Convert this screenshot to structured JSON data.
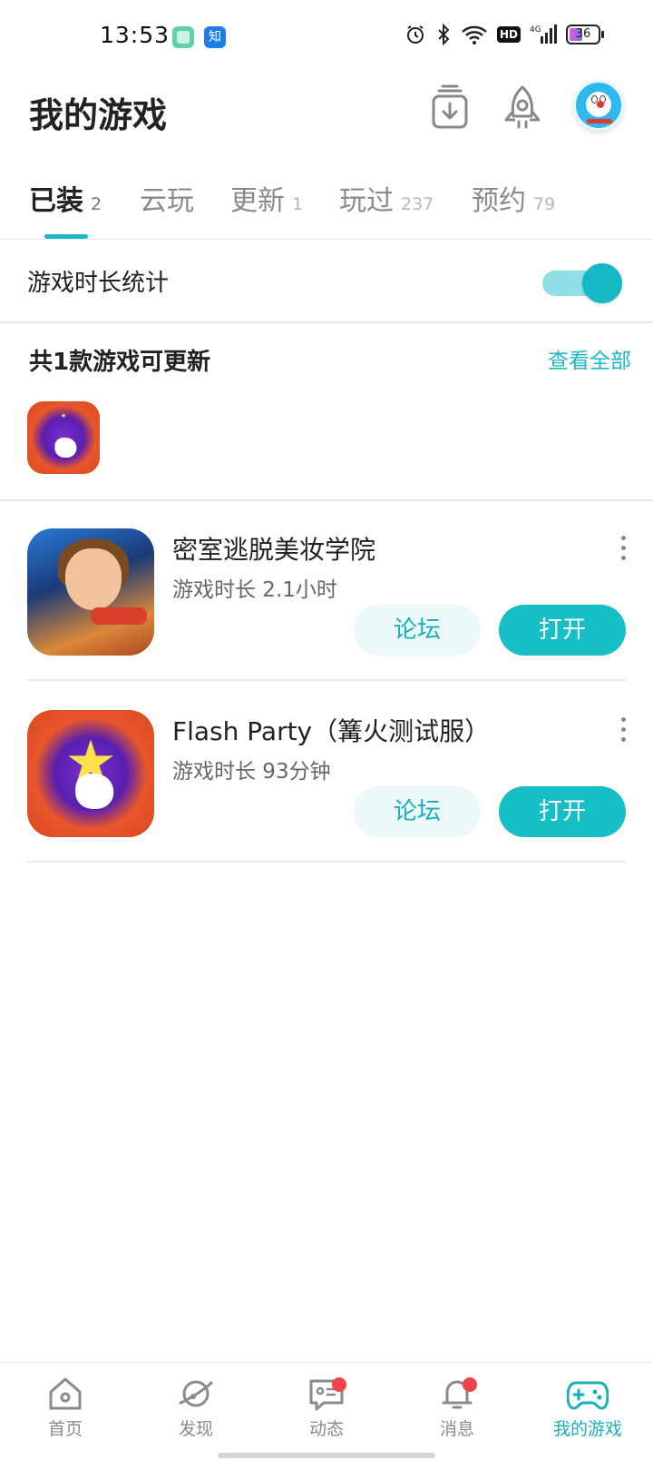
{
  "status_bar": {
    "time": "13:53",
    "app2_label": "知",
    "hd": "HD",
    "network": "4G",
    "battery": "36"
  },
  "header": {
    "title": "我的游戏"
  },
  "tabs": [
    {
      "label": "已装",
      "count": "2"
    },
    {
      "label": "云玩",
      "count": ""
    },
    {
      "label": "更新",
      "count": "1"
    },
    {
      "label": "玩过",
      "count": "237"
    },
    {
      "label": "预约",
      "count": "79"
    }
  ],
  "play_time_stats": {
    "label": "游戏时长统计",
    "enabled": true
  },
  "updates": {
    "title": "共1款游戏可更新",
    "view_all": "查看全部"
  },
  "games": [
    {
      "name": "密室逃脱美妆学院",
      "play_time": "游戏时长 2.1小时",
      "forum_label": "论坛",
      "open_label": "打开"
    },
    {
      "name": "Flash Party（篝火测试服）",
      "play_time": "游戏时长 93分钟",
      "forum_label": "论坛",
      "open_label": "打开"
    }
  ],
  "bottom_nav": [
    {
      "label": "首页",
      "icon": "home-icon"
    },
    {
      "label": "发现",
      "icon": "planet-icon"
    },
    {
      "label": "动态",
      "icon": "chat-icon"
    },
    {
      "label": "消息",
      "icon": "bell-icon"
    },
    {
      "label": "我的游戏",
      "icon": "gamepad-icon"
    }
  ],
  "colors": {
    "accent": "#16b8c6",
    "notification": "#f0434a"
  }
}
